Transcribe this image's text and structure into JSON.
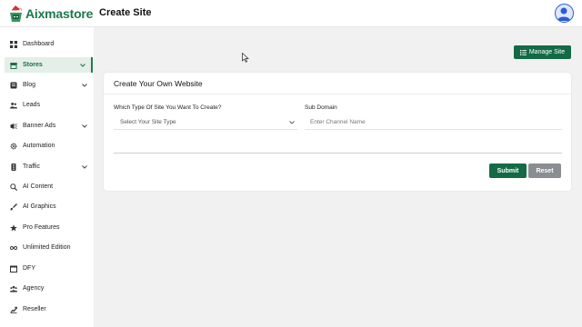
{
  "app": {
    "logo_text": "Aixmastore",
    "page_title": "Create Site"
  },
  "colors": {
    "brand_green": "#136b45",
    "active_bg": "#e3efe8",
    "reset_gray": "#8a8d92",
    "avatar_blue": "#2a5bd7"
  },
  "sidebar": {
    "items": [
      {
        "label": "Dashboard",
        "icon": "dashboard-grid-icon",
        "chevron": false,
        "active": false
      },
      {
        "label": "Stores",
        "icon": "store-icon",
        "chevron": true,
        "active": true
      },
      {
        "label": "Blog",
        "icon": "blog-icon",
        "chevron": true,
        "active": false
      },
      {
        "label": "Leads",
        "icon": "users-icon",
        "chevron": false,
        "active": false
      },
      {
        "label": "Banner Ads",
        "icon": "banner-icon",
        "chevron": true,
        "active": false
      },
      {
        "label": "Automation",
        "icon": "gear-icon",
        "chevron": false,
        "active": false
      },
      {
        "label": "Traffic",
        "icon": "traffic-icon",
        "chevron": true,
        "active": false
      },
      {
        "label": "AI Content",
        "icon": "search-icon",
        "chevron": false,
        "active": false
      },
      {
        "label": "AI Graphics",
        "icon": "brush-icon",
        "chevron": false,
        "active": false
      },
      {
        "label": "Pro Features",
        "icon": "star-icon",
        "chevron": false,
        "active": false
      },
      {
        "label": "Unlimited Edition",
        "icon": "infinity-icon",
        "chevron": false,
        "active": false
      },
      {
        "label": "DFY",
        "icon": "box-icon",
        "chevron": false,
        "active": false
      },
      {
        "label": "Agency",
        "icon": "agency-icon",
        "chevron": false,
        "active": false
      },
      {
        "label": "Reseller",
        "icon": "reseller-icon",
        "chevron": false,
        "active": false
      }
    ]
  },
  "main": {
    "manage_button": "Manage Site",
    "card": {
      "title": "Create Your Own Website",
      "site_type_label": "Which Type Of Site You Want To Create?",
      "site_type_value": "Select Your Site Type",
      "subdomain_label": "Sub Domain",
      "subdomain_placeholder": "Enter Channel Name",
      "submit_label": "Submit",
      "reset_label": "Reset"
    }
  }
}
